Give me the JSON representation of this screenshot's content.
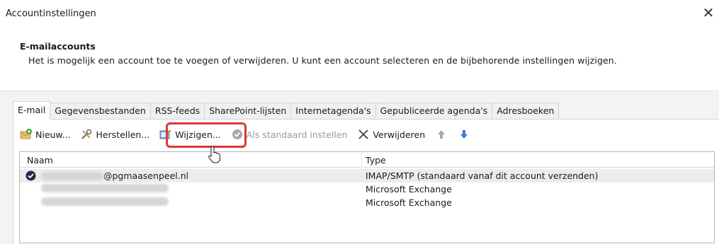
{
  "window": {
    "title": "Accountinstellingen",
    "close_glyph": "✕"
  },
  "header": {
    "title": "E-mailaccounts",
    "description": "Het is mogelijk een account toe te voegen of verwijderen. U kunt een account selecteren en de bijbehorende instellingen wijzigen."
  },
  "tabs": [
    {
      "label": "E-mail",
      "active": true
    },
    {
      "label": "Gegevensbestanden"
    },
    {
      "label": "RSS-feeds"
    },
    {
      "label": "SharePoint-lijsten"
    },
    {
      "label": "Internetagenda's"
    },
    {
      "label": "Gepubliceerde agenda's"
    },
    {
      "label": "Adresboeken"
    }
  ],
  "toolbar": {
    "new_label": "Nieuw...",
    "repair_label": "Herstellen...",
    "change_label": "Wijzigen...",
    "default_label": "Als standaard instellen",
    "remove_label": "Verwijderen",
    "up_icon": "arrow-up-icon",
    "down_icon": "arrow-down-icon"
  },
  "list": {
    "col_name": "Naam",
    "col_type": "Type",
    "rows": [
      {
        "name_suffix": "@pgmaasenpeel.nl",
        "type": "IMAP/SMTP (standaard vanaf dit account verzenden)",
        "default": true
      },
      {
        "name_suffix": "",
        "type": "Microsoft Exchange"
      },
      {
        "name_suffix": "",
        "type": "Microsoft Exchange"
      }
    ]
  },
  "colors": {
    "highlight": "#d9383a",
    "accent_blue": "#1a5fb4"
  }
}
